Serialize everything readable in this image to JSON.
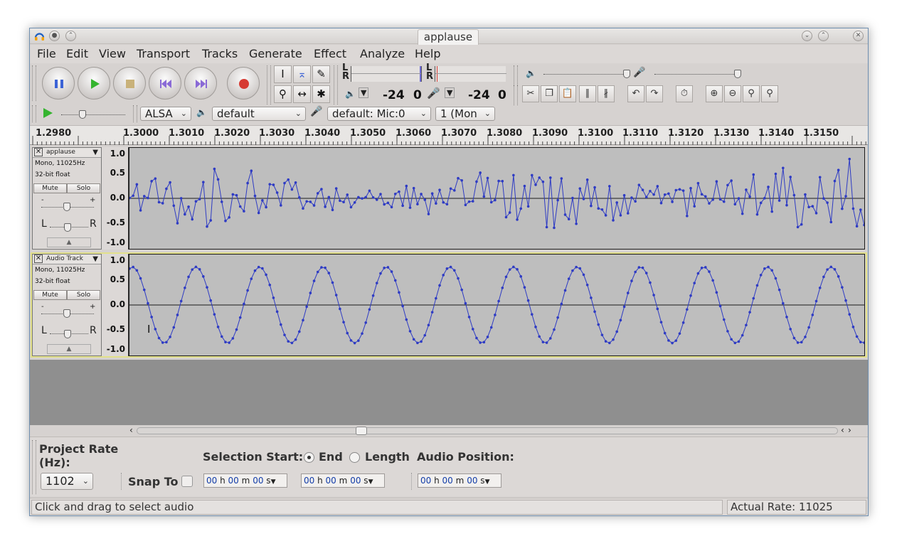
{
  "window": {
    "title": "applause"
  },
  "menu": [
    "File",
    "Edit",
    "View",
    "Transport",
    "Tracks",
    "Generate",
    "Effect",
    "Analyze",
    "Help"
  ],
  "meters": {
    "play_db": "-24",
    "play_zero": "0",
    "rec_db": "-24",
    "rec_zero": "0",
    "lr_left": "L",
    "lr_right": "R"
  },
  "device": {
    "host": "ALSA",
    "output": "default",
    "input": "default: Mic:0",
    "channels": "1 (Mon"
  },
  "ruler": {
    "labels": [
      "1.2980",
      "1.3000",
      "1.3010",
      "1.3020",
      "1.3030",
      "1.3040",
      "1.3050",
      "1.3060",
      "1.3070",
      "1.3080",
      "1.3090",
      "1.3100",
      "1.3110",
      "1.3120",
      "1.3130",
      "1.3140",
      "1.3150"
    ]
  },
  "tracks": [
    {
      "name": "applause",
      "info1": "Mono, 11025Hz",
      "info2": "32-bit float",
      "mute": "Mute",
      "solo": "Solo",
      "gain_minus": "-",
      "gain_plus": "+",
      "pan_left": "L",
      "pan_right": "R",
      "scale": [
        "1.0",
        "0.5",
        "0.0",
        "-0.5",
        "-1.0"
      ],
      "waveform": "noise"
    },
    {
      "name": "Audio Track",
      "info1": "Mono, 11025Hz",
      "info2": "32-bit float",
      "mute": "Mute",
      "solo": "Solo",
      "gain_minus": "-",
      "gain_plus": "+",
      "pan_left": "L",
      "pan_right": "R",
      "scale": [
        "1.0",
        "0.5",
        "0.0",
        "-0.5",
        "-1.0"
      ],
      "waveform": "sine"
    }
  ],
  "selection_toolbar": {
    "project_rate_label": "Project Rate (Hz):",
    "project_rate_value": "1102",
    "snap_to_label": "Snap To",
    "selection_start_label": "Selection Start:",
    "end_label": "End",
    "length_label": "Length",
    "audio_position_label": "Audio Position:",
    "time_h": "00",
    "time_m": "00",
    "time_s": "00",
    "unit_h": "h",
    "unit_m": "m",
    "unit_s": "s"
  },
  "status": {
    "message": "Click and drag to select audio",
    "rate": "Actual Rate: 11025"
  },
  "colors": {
    "waveform": "#2e3bc4",
    "track_bg": "#bebebe",
    "selected_border": "#e2e08a"
  }
}
